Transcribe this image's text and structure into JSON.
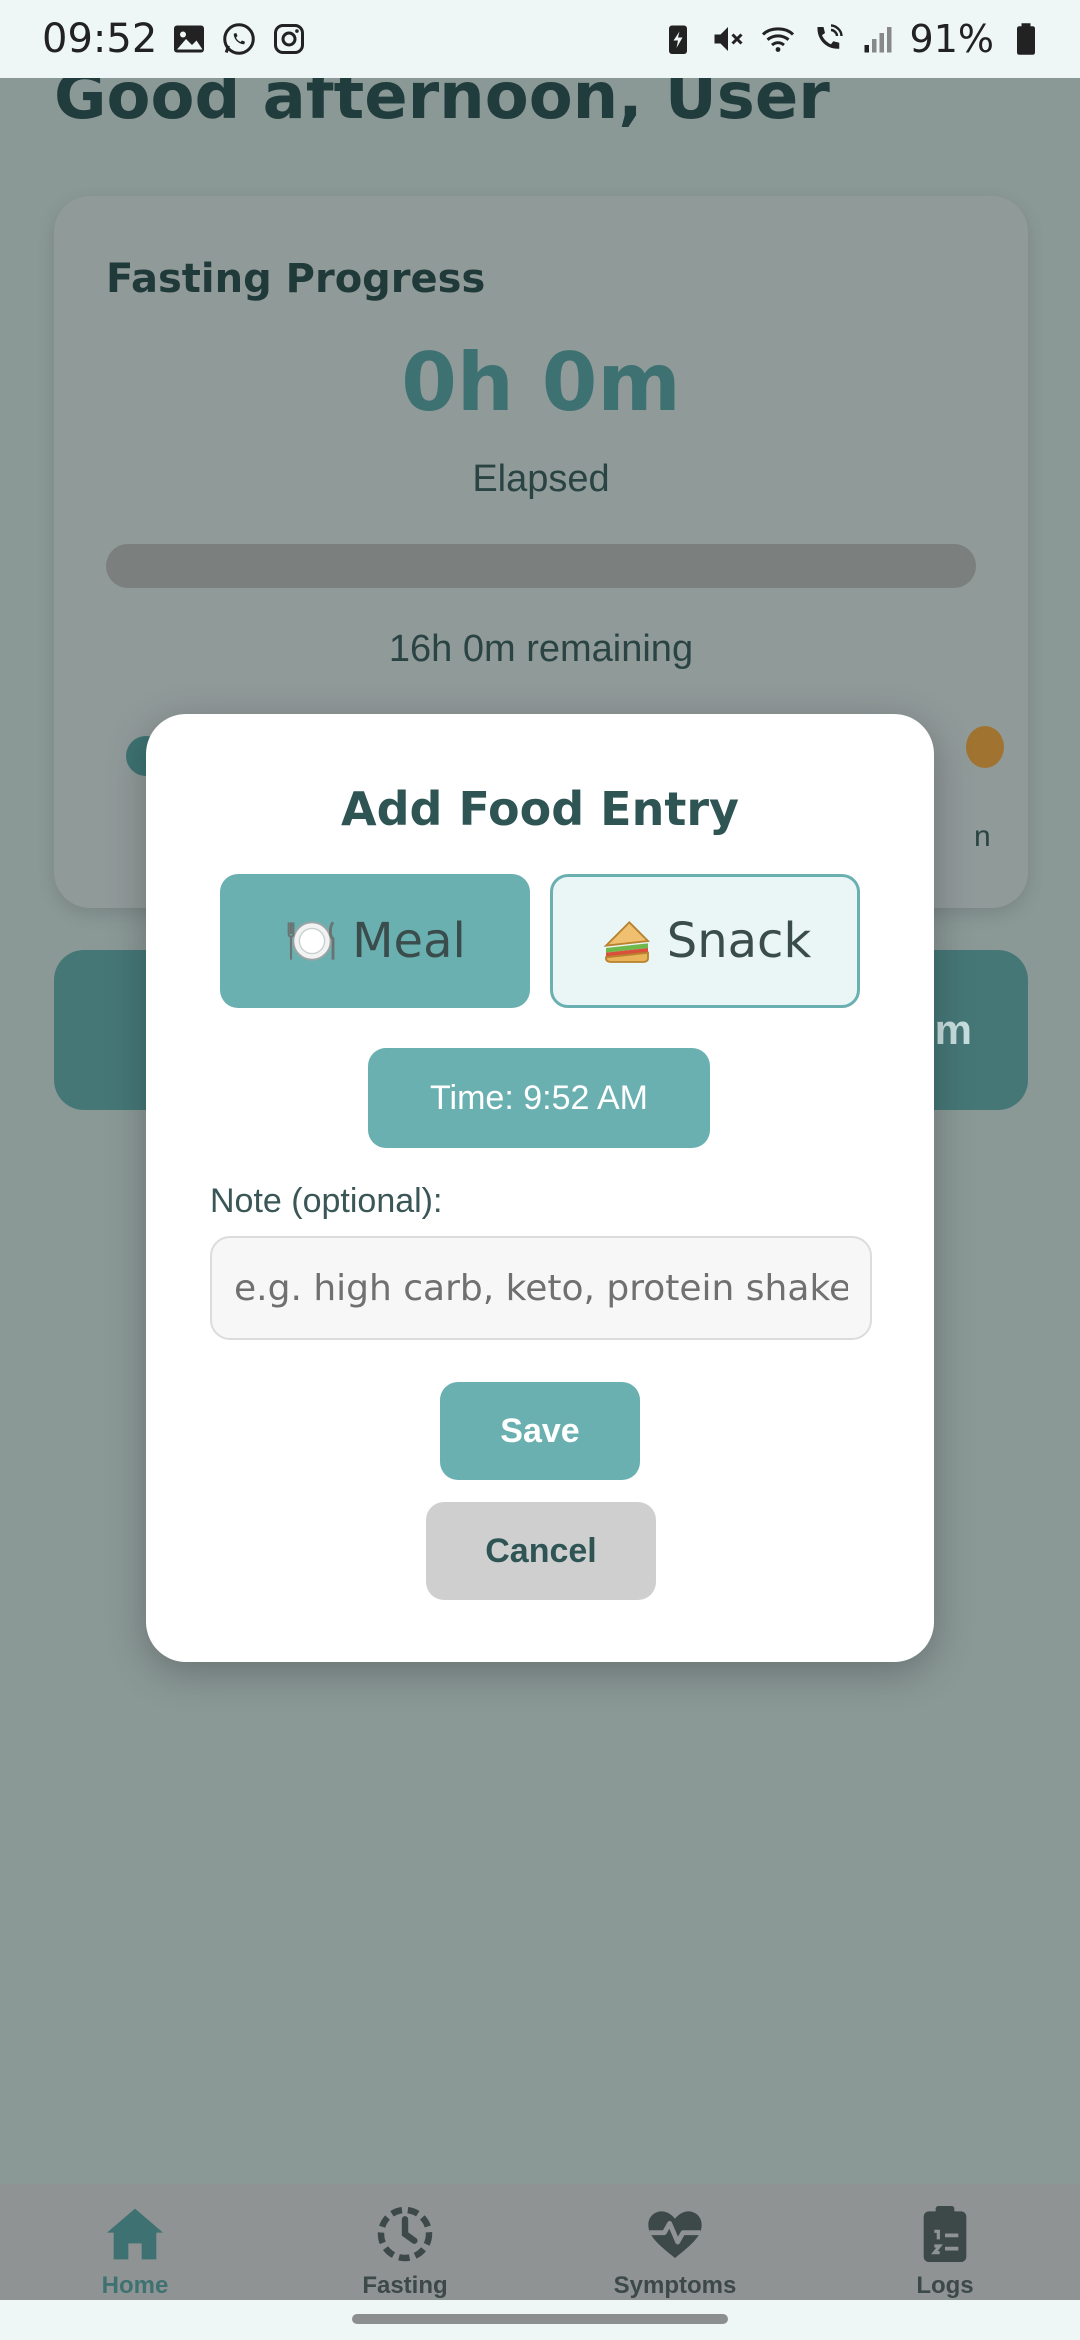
{
  "status_bar": {
    "time": "09:52",
    "battery": "91%",
    "left_icons": [
      "gallery-icon",
      "whatsapp-icon",
      "instagram-icon"
    ],
    "right_icons": [
      "battery-saver-icon",
      "mute-icon",
      "wifi-icon",
      "wifi-calling-icon",
      "signal-icon",
      "battery-icon"
    ]
  },
  "home": {
    "greeting": "Good afternoon, User",
    "progress_card": {
      "title": "Fasting Progress",
      "elapsed_value": "0h 0m",
      "elapsed_label": "Elapsed",
      "progress_fraction": 0,
      "remaining": "16h 0m remaining",
      "right_peek_text": "n"
    },
    "start_button_peek": "m"
  },
  "modal": {
    "title": "Add Food Entry",
    "meal_button": {
      "label": "Meal",
      "icon": "plate-icon",
      "selected": true
    },
    "snack_button": {
      "label": "Snack",
      "icon": "sandwich-icon",
      "selected": false
    },
    "time_button": "Time: 9:52 AM",
    "note_label": "Note (optional):",
    "note_placeholder": "e.g. high carb, keto, protein shake",
    "note_value": "",
    "save_label": "Save",
    "cancel_label": "Cancel"
  },
  "bottom_nav": {
    "items": [
      {
        "label": "Home",
        "icon": "home-icon",
        "active": true
      },
      {
        "label": "Fasting",
        "icon": "clock-icon",
        "active": false
      },
      {
        "label": "Symptoms",
        "icon": "heart-pulse-icon",
        "active": false
      },
      {
        "label": "Logs",
        "icon": "clipboard-list-icon",
        "active": false
      }
    ]
  },
  "colors": {
    "accent": "#6bb0b0",
    "accent_dark": "#3e7272",
    "overlay": "#8a9896"
  }
}
